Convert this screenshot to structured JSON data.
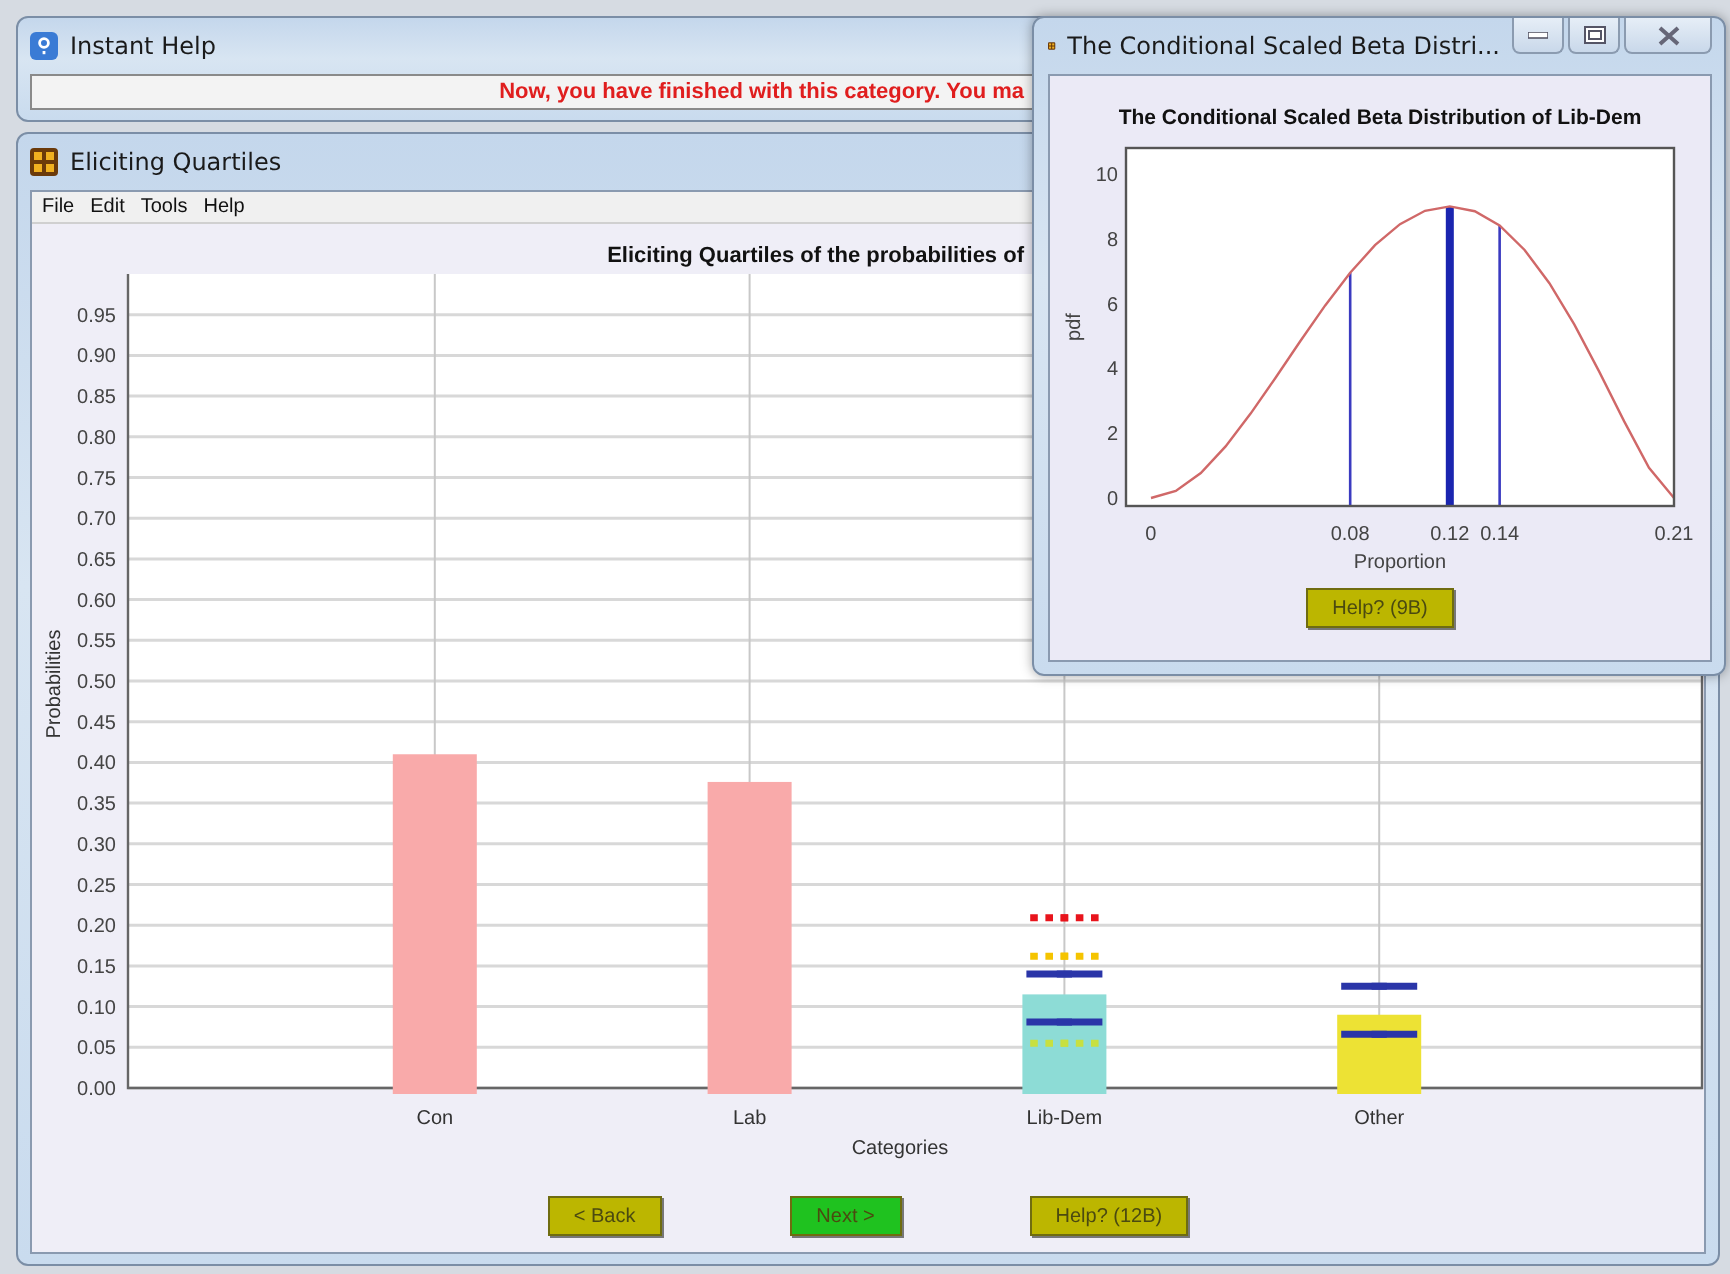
{
  "help_window": {
    "title": "Instant Help",
    "message": "Now, you have finished with this category. You ma"
  },
  "main_window": {
    "title": "Eliciting Quartiles",
    "menu": [
      "File",
      "Edit",
      "Tools",
      "Help"
    ],
    "chart_data": {
      "type": "bar",
      "title": "Eliciting Quartiles of the probabilities of",
      "xlabel": "Categories",
      "ylabel": "Probabilities",
      "categories": [
        "Con",
        "Lab",
        "Lib-Dem",
        "Other"
      ],
      "grid": true,
      "series": [
        {
          "colors": [
            "#f9aaaa",
            "#f9aaaa",
            "#8ddcd6",
            "#ede234"
          ],
          "values": [
            0.41,
            0.376,
            0.115,
            0.09
          ]
        },
        {
          "type": "scatter",
          "color": "#e8141c",
          "values": [
            null,
            null,
            0.209,
            null
          ]
        },
        {
          "type": "scatter",
          "color": "#f5c400",
          "values": [
            null,
            null,
            0.162,
            null
          ]
        },
        {
          "type": "scatter",
          "color": "#2a35a8",
          "values": [
            null,
            null,
            0.14,
            0.125
          ]
        },
        {
          "type": "scatter",
          "color": "#2a35a8",
          "values": [
            null,
            null,
            0.081,
            0.066
          ]
        },
        {
          "type": "scatter",
          "color": "#c8e040",
          "values": [
            null,
            null,
            0.055,
            null
          ]
        }
      ],
      "ylim": [
        0,
        1
      ],
      "yticks": [
        {
          "value": 0,
          "label": "0.00"
        },
        {
          "value": 0.05,
          "label": "0.05"
        },
        {
          "value": 0.1,
          "label": "0.10"
        },
        {
          "value": 0.15,
          "label": "0.15"
        },
        {
          "value": 0.2,
          "label": "0.20"
        },
        {
          "value": 0.25,
          "label": "0.25"
        },
        {
          "value": 0.3,
          "label": "0.30"
        },
        {
          "value": 0.35,
          "label": "0.35"
        },
        {
          "value": 0.4,
          "label": "0.40"
        },
        {
          "value": 0.45,
          "label": "0.45"
        },
        {
          "value": 0.5,
          "label": "0.50"
        },
        {
          "value": 0.55,
          "label": "0.55"
        },
        {
          "value": 0.6,
          "label": "0.60"
        },
        {
          "value": 0.65,
          "label": "0.65"
        },
        {
          "value": 0.7,
          "label": "0.70"
        },
        {
          "value": 0.75,
          "label": "0.75"
        },
        {
          "value": 0.8,
          "label": "0.80"
        },
        {
          "value": 0.85,
          "label": "0.85"
        },
        {
          "value": 0.9,
          "label": "0.90"
        },
        {
          "value": 0.95,
          "label": "0.95"
        }
      ],
      "orientation": "vertical"
    },
    "buttons": [
      {
        "label": "< Back",
        "kind": "plain"
      },
      {
        "label": "Next >",
        "kind": "go"
      },
      {
        "label": "Help? (12B)",
        "kind": "plain"
      }
    ]
  },
  "dialog": {
    "title": "The Conditional Scaled Beta Distri...",
    "chart_data": {
      "type": "line",
      "title": "The Conditional Scaled Beta Distribution of Lib-Dem",
      "xlabel": "Proportion",
      "ylabel": "pdf",
      "x": [
        0,
        0.01,
        0.02,
        0.03,
        0.04,
        0.05,
        0.06,
        0.07,
        0.08,
        0.09,
        0.1,
        0.11,
        0.12,
        0.13,
        0.14,
        0.15,
        0.16,
        0.17,
        0.18,
        0.19,
        0.2,
        0.21
      ],
      "series": [
        {
          "color": "#d06868",
          "values": [
            0,
            0.21,
            0.77,
            1.59,
            2.6,
            3.7,
            4.84,
            5.94,
            6.95,
            7.8,
            8.45,
            8.86,
            9,
            8.85,
            8.41,
            7.65,
            6.63,
            5.35,
            3.9,
            2.36,
            0.93,
            0
          ]
        }
      ],
      "xlim": [
        -0.01,
        0.21
      ],
      "ylim": [
        -0.25,
        10.8
      ],
      "xticks": [
        0,
        0.08,
        0.12,
        0.14,
        0.21
      ],
      "yticks": [
        0,
        2,
        4,
        6,
        8,
        10
      ],
      "ref_lines": [
        {
          "axis": "x",
          "value": 0.08
        },
        {
          "axis": "x",
          "value": 0.12
        },
        {
          "axis": "x",
          "value": 0.14
        }
      ]
    },
    "buttons": [
      {
        "label": "Help? (9B)",
        "kind": "plain"
      }
    ]
  }
}
